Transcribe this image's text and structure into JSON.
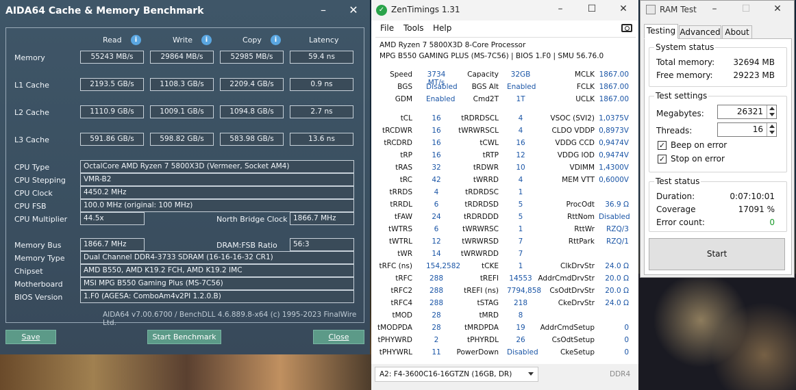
{
  "aida": {
    "title": "AIDA64 Cache & Memory Benchmark",
    "minimize": "–",
    "close": "✕",
    "headers": {
      "read": "Read",
      "write": "Write",
      "copy": "Copy",
      "latency": "Latency"
    },
    "rows": [
      {
        "label": "Memory",
        "read": "55243 MB/s",
        "write": "29864 MB/s",
        "copy": "52985 MB/s",
        "latency": "59.4 ns"
      },
      {
        "label": "L1 Cache",
        "read": "2193.5 GB/s",
        "write": "1108.3 GB/s",
        "copy": "2209.4 GB/s",
        "latency": "0.9 ns"
      },
      {
        "label": "L2 Cache",
        "read": "1110.9 GB/s",
        "write": "1009.1 GB/s",
        "copy": "1094.8 GB/s",
        "latency": "2.7 ns"
      },
      {
        "label": "L3 Cache",
        "read": "591.86 GB/s",
        "write": "598.82 GB/s",
        "copy": "583.98 GB/s",
        "latency": "13.6 ns"
      }
    ],
    "info": {
      "cpu_type_label": "CPU Type",
      "cpu_type": "OctalCore AMD Ryzen 7 5800X3D  (Vermeer, Socket AM4)",
      "cpu_stepping_label": "CPU Stepping",
      "cpu_stepping": "VMR-B2",
      "cpu_clock_label": "CPU Clock",
      "cpu_clock": "4450.2 MHz",
      "cpu_fsb_label": "CPU FSB",
      "cpu_fsb": "100.0 MHz  (original: 100 MHz)",
      "cpu_mult_label": "CPU Multiplier",
      "cpu_mult": "44.5x",
      "nb_clock_label": "North Bridge Clock",
      "nb_clock": "1866.7 MHz",
      "mem_bus_label": "Memory Bus",
      "mem_bus": "1866.7 MHz",
      "dram_fsb_label": "DRAM:FSB Ratio",
      "dram_fsb": "56:3",
      "mem_type_label": "Memory Type",
      "mem_type": "Dual Channel DDR4-3733 SDRAM  (16-16-16-32 CR1)",
      "chipset_label": "Chipset",
      "chipset": "AMD B550, AMD K19.2 FCH, AMD K19.2 IMC",
      "mobo_label": "Motherboard",
      "mobo": "MSI MPG B550 Gaming Plus (MS-7C56)",
      "bios_label": "BIOS Version",
      "bios": "1.F0  (AGESA: ComboAm4v2PI 1.2.0.B)"
    },
    "footer": "AIDA64 v7.00.6700 / BenchDLL 4.6.889.8-x64  (c) 1995-2023 FinalWire Ltd.",
    "buttons": {
      "save": "Save",
      "start": "Start Benchmark",
      "close": "Close"
    }
  },
  "zen": {
    "title": "ZenTimings 1.31",
    "menu": [
      "File",
      "Tools",
      "Help"
    ],
    "cpu": "AMD Ryzen 7 5800X3D 8-Core Processor",
    "board": "MPG B550 GAMING PLUS (MS-7C56) | BIOS 1.F0 | SMU 56.76.0",
    "top": [
      [
        "Speed",
        "3734 MT/s",
        "Capacity",
        "32GB",
        "MCLK",
        "1867.00"
      ],
      [
        "BGS",
        "Disabled",
        "BGS Alt",
        "Enabled",
        "FCLK",
        "1867.00"
      ],
      [
        "GDM",
        "Enabled",
        "Cmd2T",
        "1T",
        "UCLK",
        "1867.00"
      ]
    ],
    "grid": [
      [
        "tCL",
        "16",
        "tRDRDSCL",
        "4",
        "VSOC (SVI2)",
        "1,0375V"
      ],
      [
        "tRCDWR",
        "16",
        "tWRWRSCL",
        "4",
        "CLDO VDDP",
        "0,8973V"
      ],
      [
        "tRCDRD",
        "16",
        "tCWL",
        "16",
        "VDDG CCD",
        "0,9474V"
      ],
      [
        "tRP",
        "16",
        "tRTP",
        "12",
        "VDDG IOD",
        "0,9474V"
      ],
      [
        "tRAS",
        "32",
        "tRDWR",
        "10",
        "VDIMM",
        "1,4300V"
      ],
      [
        "tRC",
        "42",
        "tWRRD",
        "4",
        "MEM VTT",
        "0,6000V"
      ],
      [
        "tRRDS",
        "4",
        "tRDRDSC",
        "1",
        "",
        ""
      ],
      [
        "tRRDL",
        "6",
        "tRDRDSD",
        "5",
        "ProcOdt",
        "36.9 Ω"
      ],
      [
        "tFAW",
        "24",
        "tRDRDDD",
        "5",
        "RttNom",
        "Disabled"
      ],
      [
        "tWTRS",
        "6",
        "tWRWRSC",
        "1",
        "RttWr",
        "RZQ/3"
      ],
      [
        "tWTRL",
        "12",
        "tWRWRSD",
        "7",
        "RttPark",
        "RZQ/1"
      ],
      [
        "tWR",
        "14",
        "tWRWRDD",
        "7",
        "",
        ""
      ],
      [
        "tRFC (ns)",
        "154,2582",
        "tCKE",
        "1",
        "ClkDrvStr",
        "24.0 Ω"
      ],
      [
        "tRFC",
        "288",
        "tREFI",
        "14553",
        "AddrCmdDrvStr",
        "20.0 Ω"
      ],
      [
        "tRFC2",
        "288",
        "tREFI (ns)",
        "7794,858",
        "CsOdtDrvStr",
        "20.0 Ω"
      ],
      [
        "tRFC4",
        "288",
        "tSTAG",
        "218",
        "CkeDrvStr",
        "24.0 Ω"
      ],
      [
        "tMOD",
        "28",
        "tMRD",
        "8",
        "",
        ""
      ],
      [
        "tMODPDA",
        "28",
        "tMRDPDA",
        "19",
        "AddrCmdSetup",
        "0"
      ],
      [
        "tPHYWRD",
        "2",
        "tPHYRDL",
        "26",
        "CsOdtSetup",
        "0"
      ],
      [
        "tPHYWRL",
        "11",
        "PowerDown",
        "Disabled",
        "CkeSetup",
        "0"
      ]
    ],
    "dimm": "A2: F4-3600C16-16GTZN (16GB, DR)",
    "ddr": "DDR4"
  },
  "ram": {
    "title": "RAM Test",
    "tabs": [
      "Testing",
      "Advanced",
      "About"
    ],
    "status_group": "System status",
    "total_label": "Total memory:",
    "total": "32694 MB",
    "free_label": "Free memory:",
    "free": "29223 MB",
    "settings_group": "Test settings",
    "mb_label": "Megabytes:",
    "mb": "26321",
    "threads_label": "Threads:",
    "threads": "16",
    "beep_label": "Beep on error",
    "stop_label": "Stop on error",
    "test_group": "Test status",
    "duration_label": "Duration:",
    "duration": "0:07:10:01",
    "coverage_label": "Coverage",
    "coverage": "17091 %",
    "errors_label": "Error count:",
    "errors": "0",
    "start": "Start"
  }
}
